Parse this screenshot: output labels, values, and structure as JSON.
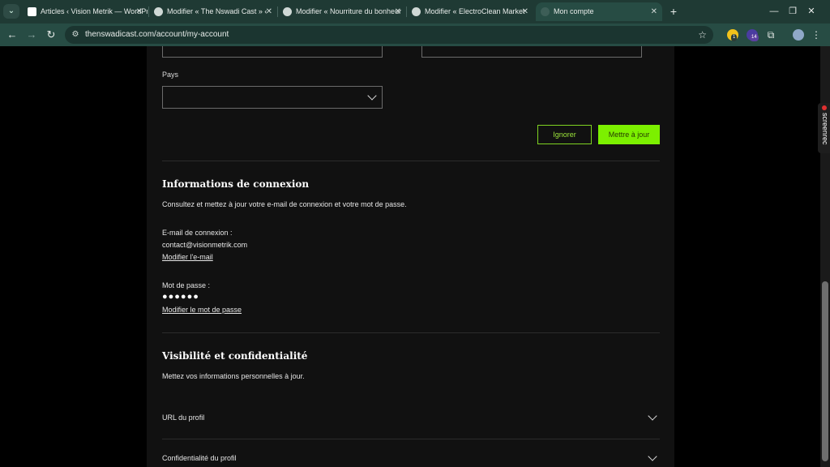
{
  "browser": {
    "tabs": [
      {
        "title": "Articles ‹ Vision Metrik — WordPress",
        "active": false
      },
      {
        "title": "Modifier « The Nswadi Cast » ‹",
        "active": false
      },
      {
        "title": "Modifier « Nourriture du bonheur",
        "active": false
      },
      {
        "title": "Modifier « ElectroClean Market",
        "active": false
      },
      {
        "title": "Mon compte",
        "active": true
      }
    ],
    "url": "thenswadicast.com/account/my-account",
    "extension_badge": "14",
    "extension_badge_small": "1"
  },
  "form": {
    "country_label": "Pays",
    "country_value": "",
    "ignore_label": "Ignorer",
    "update_label": "Mettre à jour"
  },
  "login_info": {
    "title": "Informations de connexion",
    "description": "Consultez et mettez à jour votre e-mail de connexion et votre mot de passe.",
    "email_label": "E-mail de connexion :",
    "email_value": "contact@visionmetrik.com",
    "change_email_link": "Modifier l'e-mail",
    "password_label": "Mot de passe :",
    "password_value": "●●●●●●",
    "change_password_link": "Modifier le mot de passe"
  },
  "privacy": {
    "title": "Visibilité et confidentialité",
    "description": "Mettez vos informations personnelles à jour.",
    "sections": [
      "URL du profil",
      "Confidentialité du profil"
    ]
  },
  "overlay": {
    "screenrec": "screenrec"
  },
  "colors": {
    "accent": "#7cf000",
    "card": "#111111",
    "chrome": "#274c44"
  }
}
